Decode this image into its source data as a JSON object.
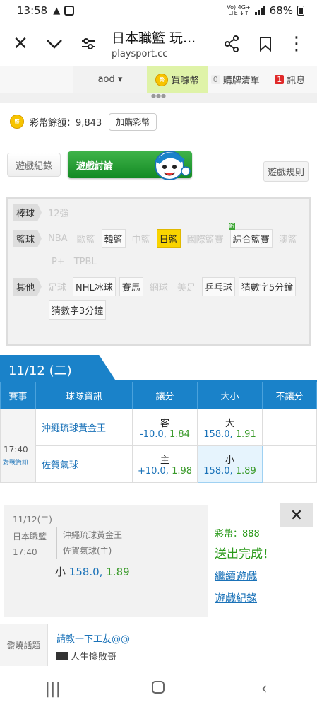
{
  "status": {
    "time": "13:58",
    "network": "Vo) 4G+",
    "network_sub": "LTE ↓↑",
    "battery": "68%"
  },
  "browser": {
    "title": "日本職籃 玩...",
    "url": "playsport.cc"
  },
  "sitenav": {
    "account": "aod ▾",
    "buy": "買噱幣",
    "cart_count": "0",
    "cart": "購牌清單",
    "msg_count": "1",
    "msg": "訊息"
  },
  "balance": {
    "label": "彩幣餘額：9,843",
    "add_button": "加購彩幣"
  },
  "tabs": {
    "log": "遊戲紀錄",
    "discuss": "遊戲討論",
    "rules": "遊戲規則"
  },
  "categories": {
    "baseball": {
      "label": "棒球",
      "items": [
        "12強"
      ]
    },
    "basketball": {
      "label": "籃球",
      "items": [
        "NBA",
        "歐籃",
        "韓籃",
        "中籃",
        "日籃",
        "國際籃賽",
        "綜合籃賽",
        "澳籃",
        "P+",
        "TPBL"
      ]
    },
    "other": {
      "label": "其他",
      "items": [
        "足球",
        "NHL冰球",
        "賽馬",
        "網球",
        "美足",
        "乒乓球",
        "猜數字5分鐘",
        "猜數字3分鐘"
      ]
    }
  },
  "date": "11/12 (二)",
  "table": {
    "headers": [
      "賽事",
      "球隊資訊",
      "讓分",
      "大小",
      "不讓分"
    ],
    "time": "17:40",
    "versus": "對戰資訊",
    "away": {
      "team": "沖繩琉球黃金王",
      "spread_side": "客",
      "spread_val": "-10.0, ",
      "spread_price": "1.84",
      "total_side": "大",
      "total_val": "158.0, ",
      "total_price": "1.91"
    },
    "home": {
      "team": "佐賀氣球",
      "spread_side": "主",
      "spread_val": "+10.0, ",
      "spread_price": "1.98",
      "total_side": "小",
      "total_val": "158.0, ",
      "total_price": "1.89"
    }
  },
  "popup": {
    "date": "11/12(二)",
    "league": "日本職籃",
    "time": "17:40",
    "away": "沖繩琉球黃金王",
    "home": "佐賀氣球(主)",
    "bet_side": "小 ",
    "bet_val": "158.0, ",
    "bet_price": "1.89",
    "coins": "彩幣：888",
    "done": "送出完成！",
    "continue": "繼續遊戲",
    "log": "遊戲紀錄"
  },
  "topic": {
    "label": "發燒話題",
    "title": "請教一下工友@@",
    "author": "人生慘敗哥"
  }
}
